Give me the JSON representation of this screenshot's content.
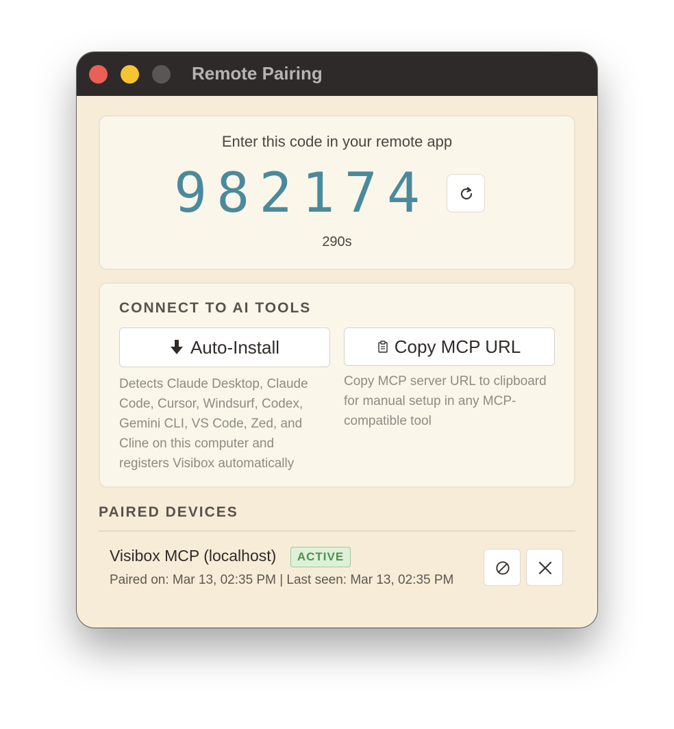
{
  "window": {
    "title": "Remote Pairing"
  },
  "pairing": {
    "prompt": "Enter this code in your remote app",
    "code": "982174",
    "countdown": "290s",
    "code_color": "#4a8a9c"
  },
  "ai_tools": {
    "heading": "CONNECT TO AI TOOLS",
    "auto_install": {
      "icon": "download-arrow-icon",
      "label": "Auto-Install",
      "description": "Detects Claude Desktop, Claude Code, Cursor, Windsurf, Codex, Gemini CLI, VS Code, Zed, and Cline on this computer and registers Visibox automatically"
    },
    "copy_url": {
      "icon": "clipboard-icon",
      "label": "Copy MCP URL",
      "description": "Copy MCP server URL to clipboard for manual setup in any MCP-compatible tool"
    }
  },
  "paired_devices": {
    "heading": "PAIRED DEVICES",
    "devices": [
      {
        "name": "Visibox MCP (localhost)",
        "status": "ACTIVE",
        "status_color": "#4f8f55",
        "meta": "Paired on: Mar 13, 02:35 PM | Last seen: Mar 13, 02:35 PM",
        "actions": [
          "revoke-icon",
          "close-icon"
        ]
      }
    ]
  }
}
